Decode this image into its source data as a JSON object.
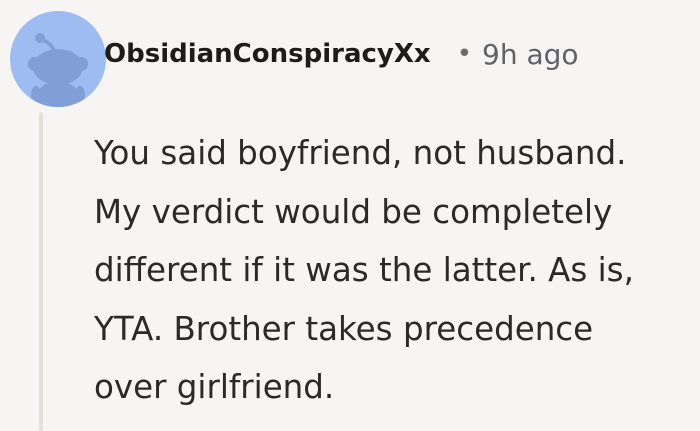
{
  "comment": {
    "author": "ObsidianConspiracyXx",
    "separator": "•",
    "timestamp": "9h ago",
    "body_lines": [
      "You said boyfriend, not husband.",
      "My verdict would be completely",
      "different if it was the latter. As is,",
      "YTA. Brother takes precedence",
      "over girlfriend."
    ],
    "avatar_icon": "reddit-snoo-icon"
  },
  "colors": {
    "background": "#f7f5f3",
    "avatar_bg": "#9cbcf2",
    "avatar_figure": "#7f9fd6",
    "thread_line": "#e6e0d8",
    "username": "#1c1c1c",
    "meta": "#5f6368",
    "body_text": "#2a2a2a"
  }
}
